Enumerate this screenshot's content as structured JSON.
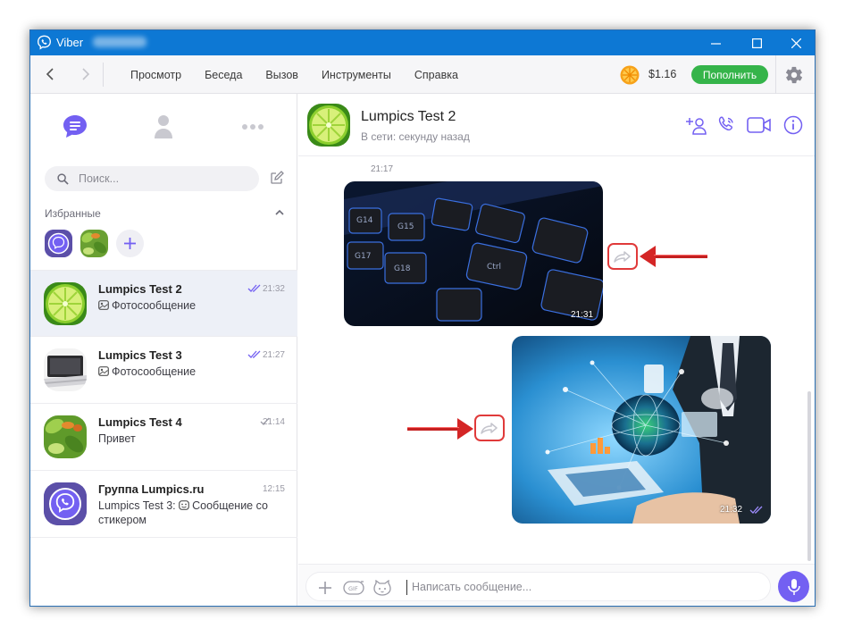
{
  "window": {
    "title": "Viber"
  },
  "toolbar": {
    "menu": [
      "Просмотр",
      "Беседа",
      "Вызов",
      "Инструменты",
      "Справка"
    ],
    "balance": "$1.16",
    "topup_label": "Пополнить"
  },
  "sidebar": {
    "search_placeholder": "Поиск...",
    "favorites_label": "Избранные",
    "chats": [
      {
        "name": "Lumpics Test 2",
        "time": "21:32",
        "preview": "Фотосообщение",
        "preview_icon": "photo-icon",
        "status": "read"
      },
      {
        "name": "Lumpics Test 3",
        "time": "21:27",
        "preview": "Фотосообщение",
        "preview_icon": "photo-icon",
        "status": "read"
      },
      {
        "name": "Lumpics Test 4",
        "time": "21:14",
        "preview": "Привет",
        "status": "delivered"
      },
      {
        "name": "Группа Lumpics.ru",
        "time": "12:15",
        "preview_sender": "Lumpics Test 3:",
        "preview": "Сообщение со стикером",
        "preview_icon": "sticker-icon"
      }
    ]
  },
  "chat": {
    "name": "Lumpics Test 2",
    "status": "В сети: секунду назад",
    "messages": [
      {
        "sent_label": "21:17",
        "time": "21:31",
        "type": "photo",
        "subject": "keyboard"
      },
      {
        "time": "21:32",
        "type": "photo",
        "subject": "technology",
        "status": "read"
      }
    ],
    "composer_placeholder": "Написать сообщение..."
  },
  "colors": {
    "titlebar": "#0d78d4",
    "accent": "#7360f2",
    "topup": "#35b44a",
    "highlight_arrow": "#e03a3a"
  }
}
